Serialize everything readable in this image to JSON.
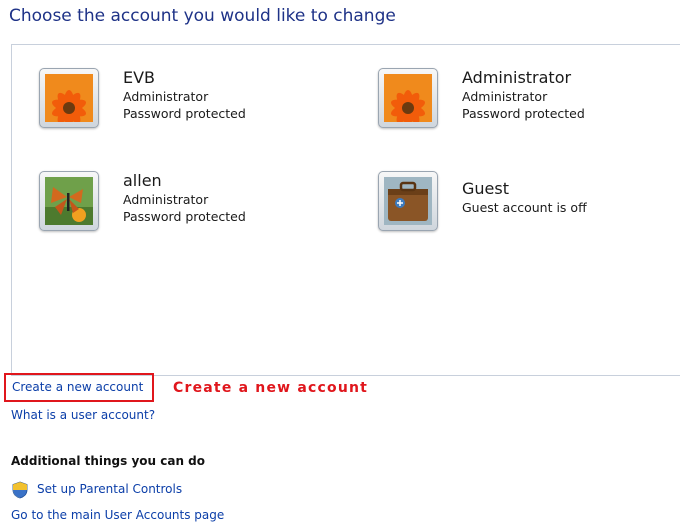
{
  "page": {
    "title": "Choose the account you would like to change"
  },
  "accounts": [
    {
      "name": "EVB",
      "type": "Administrator",
      "status": "Password protected",
      "picture": "orange-gerbera-flower"
    },
    {
      "name": "Administrator",
      "type": "Administrator",
      "status": "Password protected",
      "picture": "orange-gerbera-flower"
    },
    {
      "name": "allen",
      "type": "Administrator",
      "status": "Password protected",
      "picture": "butterfly-on-flower"
    },
    {
      "name": "Guest",
      "status": "Guest account is off",
      "picture": "suitcase-guest"
    }
  ],
  "links": {
    "create_account": "Create a new account",
    "what_is_account": "What is a user account?"
  },
  "annotation": {
    "text": "Create a new account",
    "color": "#e0161c"
  },
  "additional": {
    "heading": "Additional things you can do",
    "parental_controls": "Set up Parental Controls",
    "main_page": "Go to the main User Accounts page"
  },
  "colors": {
    "title": "#1e3287",
    "link": "#0b3ea8",
    "annotation": "#e0161c"
  },
  "icons": [
    "shield-icon"
  ]
}
